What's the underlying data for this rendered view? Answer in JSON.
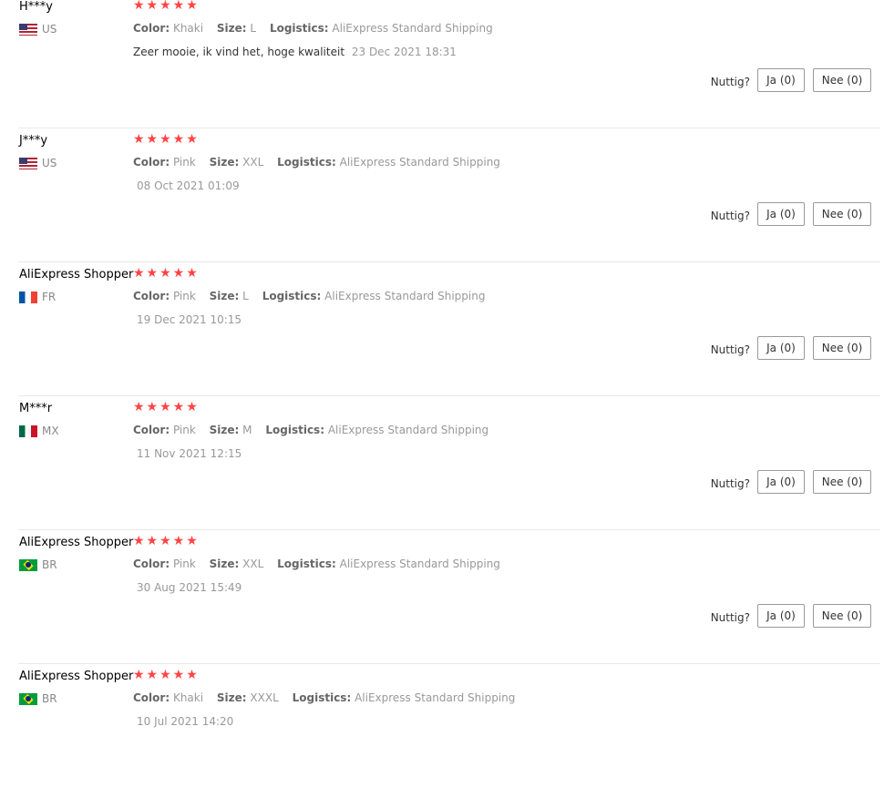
{
  "labels": {
    "color": "Color:",
    "size": "Size:",
    "logistics": "Logistics:",
    "helpful": "Nuttig?",
    "yes": "Ja (0)",
    "no": "Nee (0)"
  },
  "colors": {
    "star": "#ff4747",
    "divider": "#e8e8e8"
  },
  "reviews": [
    {
      "user": "H***y",
      "country": "US",
      "flag": "us",
      "stars": "★★★★★",
      "color": "Khaki",
      "size": "L",
      "logistics": "AliExpress Standard Shipping",
      "text": "Zeer mooie, ik vind het, hoge kwaliteit",
      "date": "23 Dec 2021 18:31"
    },
    {
      "user": "J***y",
      "country": "US",
      "flag": "us",
      "stars": "★★★★★",
      "color": "Pink",
      "size": "XXL",
      "logistics": "AliExpress Standard Shipping",
      "text": "",
      "date": "08 Oct 2021 01:09"
    },
    {
      "user": "AliExpress Shopper",
      "country": "FR",
      "flag": "fr",
      "stars": "★★★★★",
      "color": "Pink",
      "size": "L",
      "logistics": "AliExpress Standard Shipping",
      "text": "",
      "date": "19 Dec 2021 10:15"
    },
    {
      "user": "M***r",
      "country": "MX",
      "flag": "mx",
      "stars": "★★★★★",
      "color": "Pink",
      "size": "M",
      "logistics": "AliExpress Standard Shipping",
      "text": "",
      "date": "11 Nov 2021 12:15"
    },
    {
      "user": "AliExpress Shopper",
      "country": "BR",
      "flag": "br",
      "stars": "★★★★★",
      "color": "Pink",
      "size": "XXL",
      "logistics": "AliExpress Standard Shipping",
      "text": "",
      "date": "30 Aug 2021 15:49"
    },
    {
      "user": "AliExpress Shopper",
      "country": "BR",
      "flag": "br",
      "stars": "★★★★★",
      "color": "Khaki",
      "size": "XXXL",
      "logistics": "AliExpress Standard Shipping",
      "text": "",
      "date": "10 Jul 2021 14:20"
    }
  ]
}
